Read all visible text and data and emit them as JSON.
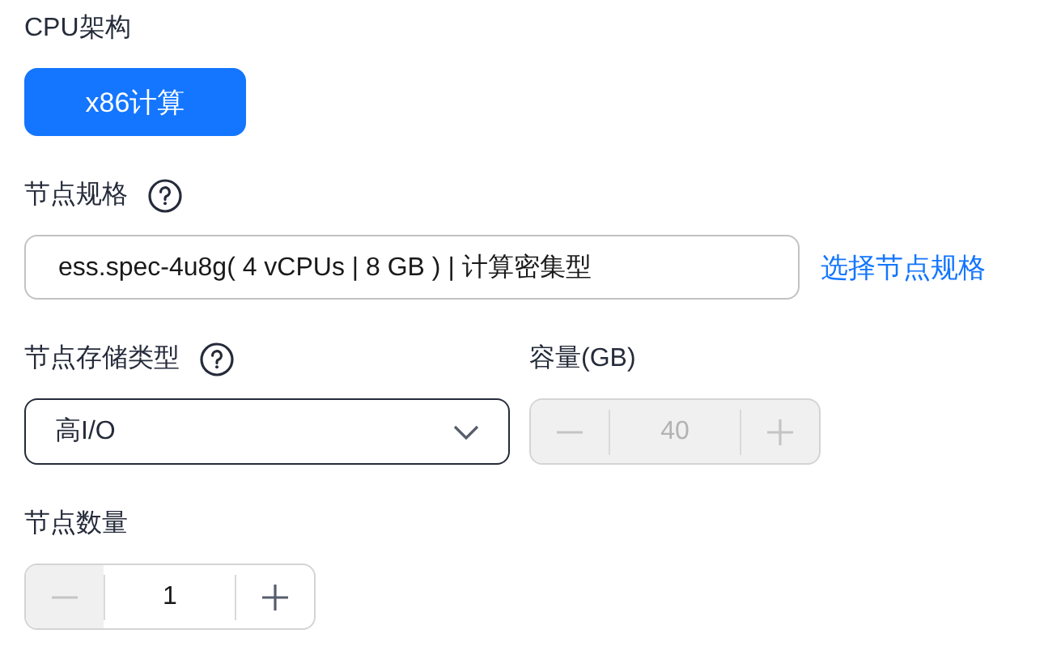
{
  "cpu_architecture": {
    "label": "CPU架构",
    "options": [
      {
        "label": "x86计算",
        "selected": true
      }
    ]
  },
  "node_spec": {
    "label": "节点规格",
    "value": "ess.spec-4u8g( 4 vCPUs | 8 GB ) | 计算密集型",
    "link": "选择节点规格"
  },
  "storage_type": {
    "label": "节点存储类型",
    "value": "高I/O"
  },
  "capacity": {
    "label": "容量(GB)",
    "value": "40",
    "disabled": true
  },
  "node_count": {
    "label": "节点数量",
    "value": "1",
    "disabled": false,
    "decrement_disabled": true
  }
}
